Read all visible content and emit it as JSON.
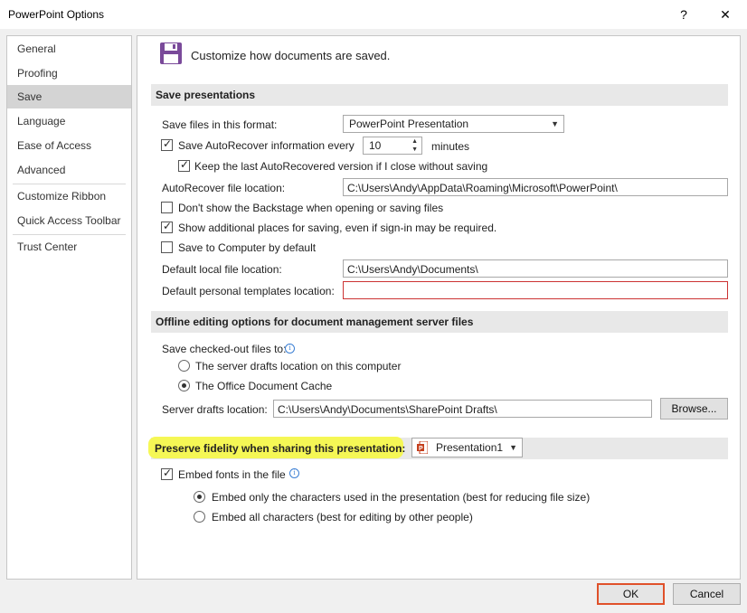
{
  "window": {
    "title": "PowerPoint Options",
    "help_glyph": "?",
    "close_glyph": "✕"
  },
  "nav": {
    "items": [
      {
        "label": "General"
      },
      {
        "label": "Proofing"
      },
      {
        "label": "Save"
      },
      {
        "label": "Language"
      },
      {
        "label": "Ease of Access"
      },
      {
        "label": "Advanced"
      },
      {
        "label": "Customize Ribbon"
      },
      {
        "label": "Quick Access Toolbar"
      },
      {
        "label": "Trust Center"
      }
    ],
    "selected": "Save"
  },
  "header": {
    "icon": "floppy-disk-icon",
    "text": "Customize how documents are saved."
  },
  "save_presentations": {
    "heading": "Save presentations",
    "format_label": "Save files in this format:",
    "format_value": "PowerPoint Presentation",
    "autorecover_label": "Save AutoRecover information every",
    "autorecover_checked": true,
    "autorecover_minutes": "10",
    "minutes_label": "minutes",
    "keep_last_label": "Keep the last AutoRecovered version if I close without saving",
    "keep_last_checked": true,
    "autorecover_location_label": "AutoRecover file location:",
    "autorecover_location_value": "C:\\Users\\Andy\\AppData\\Roaming\\Microsoft\\PowerPoint\\",
    "dont_show_backstage_label": "Don't show the Backstage when opening or saving files",
    "dont_show_backstage_checked": false,
    "show_additional_label": "Show additional places for saving, even if sign-in may be required.",
    "show_additional_checked": true,
    "save_to_computer_label": "Save to Computer by default",
    "save_to_computer_checked": false,
    "default_local_label": "Default local file location:",
    "default_local_value": "C:\\Users\\Andy\\Documents\\",
    "personal_templates_label": "Default personal templates location:",
    "personal_templates_value": ""
  },
  "offline": {
    "heading": "Offline editing options for document management server files",
    "checked_out_label": "Save checked-out files to:",
    "option_server": "The server drafts location on this computer",
    "option_cache": "The Office Document Cache",
    "selected_option": "cache",
    "server_drafts_label": "Server drafts location:",
    "server_drafts_value": "C:\\Users\\Andy\\Documents\\SharePoint Drafts\\",
    "browse_label": "Browse..."
  },
  "fidelity": {
    "heading": "Preserve fidelity when sharing this presentation:",
    "presentation_value": "Presentation1",
    "embed_fonts_label": "Embed fonts in the file",
    "embed_fonts_checked": true,
    "embed_only_label": "Embed only the characters used in the presentation (best for reducing file size)",
    "embed_all_label": "Embed all characters (best for editing by other people)",
    "selected_embed": "only",
    "highlight_color": "#f6f84d"
  },
  "footer": {
    "ok_label": "OK",
    "cancel_label": "Cancel",
    "ok_border_color": "#e0512a"
  }
}
